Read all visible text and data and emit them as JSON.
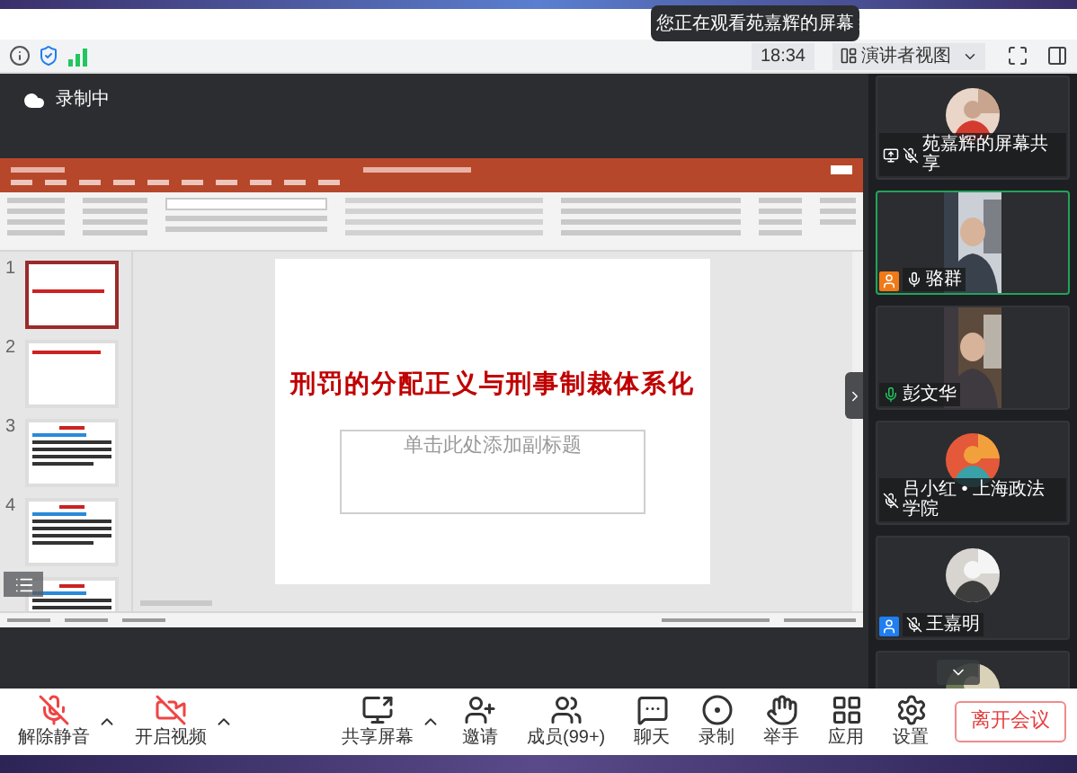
{
  "toast": {
    "text": "您正在观看苑嘉辉的屏幕"
  },
  "top_bar": {
    "time": "18:34",
    "view_mode": "演讲者视图"
  },
  "recording": {
    "label": "录制中"
  },
  "presentation": {
    "slides": [
      {
        "number": "1",
        "selected": true,
        "kind": "title"
      },
      {
        "number": "2",
        "selected": false,
        "kind": "heading"
      },
      {
        "number": "3",
        "selected": false,
        "kind": "text"
      },
      {
        "number": "4",
        "selected": false,
        "kind": "text"
      },
      {
        "selected": false,
        "kind": "text"
      }
    ],
    "slide_title": "刑罚的分配正义与刑事制裁体系化",
    "subtitle_placeholder": "单击此处添加副标题"
  },
  "participants": [
    {
      "name": "苑嘉辉的屏幕共享",
      "sharing": true,
      "muted": true,
      "host": false,
      "cohost": false,
      "kind": "avatar",
      "speaking": false
    },
    {
      "name": "骆群",
      "sharing": false,
      "muted": false,
      "talking": false,
      "host": true,
      "cohost": false,
      "kind": "video",
      "speaking": true
    },
    {
      "name": "彭文华",
      "sharing": false,
      "muted": false,
      "talking": true,
      "host": false,
      "cohost": false,
      "kind": "video",
      "speaking": false
    },
    {
      "name": "吕小红 • 上海政法学院",
      "sharing": false,
      "muted": true,
      "host": false,
      "cohost": false,
      "kind": "avatar",
      "speaking": false
    },
    {
      "name": "王嘉明",
      "sharing": false,
      "muted": true,
      "host": false,
      "cohost": true,
      "kind": "avatar",
      "speaking": false
    },
    {
      "kind": "avatar",
      "speaking": false
    }
  ],
  "toolbar": [
    {
      "label": "解除静音",
      "kind": "mute",
      "caret": true
    },
    {
      "label": "开启视频",
      "kind": "video",
      "caret": true
    },
    {
      "label": "共享屏幕",
      "kind": "share",
      "caret": true
    },
    {
      "label": "邀请",
      "kind": "invite",
      "caret": false
    },
    {
      "label": "成员(99+)",
      "kind": "members",
      "caret": false
    },
    {
      "label": "聊天",
      "kind": "chat",
      "caret": false
    },
    {
      "label": "录制",
      "kind": "record",
      "caret": false
    },
    {
      "label": "举手",
      "kind": "hand",
      "caret": false
    },
    {
      "label": "应用",
      "kind": "apps",
      "caret": false
    },
    {
      "label": "设置",
      "kind": "settings",
      "caret": false
    }
  ],
  "leave_button": "离开会议"
}
